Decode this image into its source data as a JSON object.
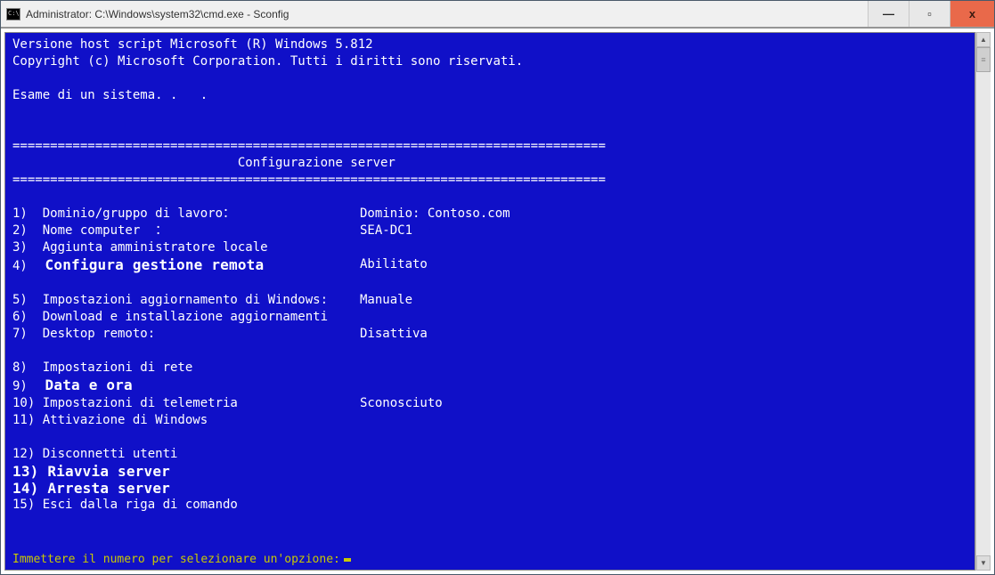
{
  "titlebar": {
    "title": "Administrator: C:\\Windows\\system32\\cmd.exe - Sconfig",
    "minimize": "—",
    "maximize": "▫",
    "close": "x"
  },
  "header": {
    "line1": "Versione host script Microsoft (R) Windows 5.812",
    "line2": "Copyright (c) Microsoft Corporation. Tutti i diritti sono riservati.",
    "exam": "Esame di un sistema. .   .",
    "divider": "===============================================================================",
    "section_title": "                              Configurazione server"
  },
  "items": {
    "i1_num": "1)",
    "i1_label": "  Dominio/gruppo di lavoro：",
    "i1_value": "Dominio: Contoso.com",
    "i2_num": "2)",
    "i2_label": "  Nome computer  ：",
    "i2_value": "SEA-DC1",
    "i3_num": "3)",
    "i3_label": "  Aggiunta amministratore locale",
    "i4_num": "4)",
    "i4_label": "  Configura gestione remota",
    "i4_value": "Abilitato",
    "i5_num": "5)",
    "i5_label": "  Impostazioni aggiornamento di Windows:",
    "i5_value": "Manuale",
    "i6_num": "6)",
    "i6_label": "  Download e installazione aggiornamenti",
    "i7_num": "7)",
    "i7_label": "  Desktop remoto:",
    "i7_value": "Disattiva",
    "i8_num": "8)",
    "i8_label": "  Impostazioni di rete",
    "i9_num": "9)",
    "i9_label": "  Data e ora",
    "i10": "10) Impostazioni di telemetria",
    "i10_value": "Sconosciuto",
    "i11": "11) Attivazione di Windows",
    "i12": "12) Disconnetti utenti",
    "i13": "13) Riavvia server",
    "i14": "14) Arresta server",
    "i15": "15) Esci dalla riga di comando"
  },
  "prompt": "Immettere il numero per selezionare un'opzione:"
}
